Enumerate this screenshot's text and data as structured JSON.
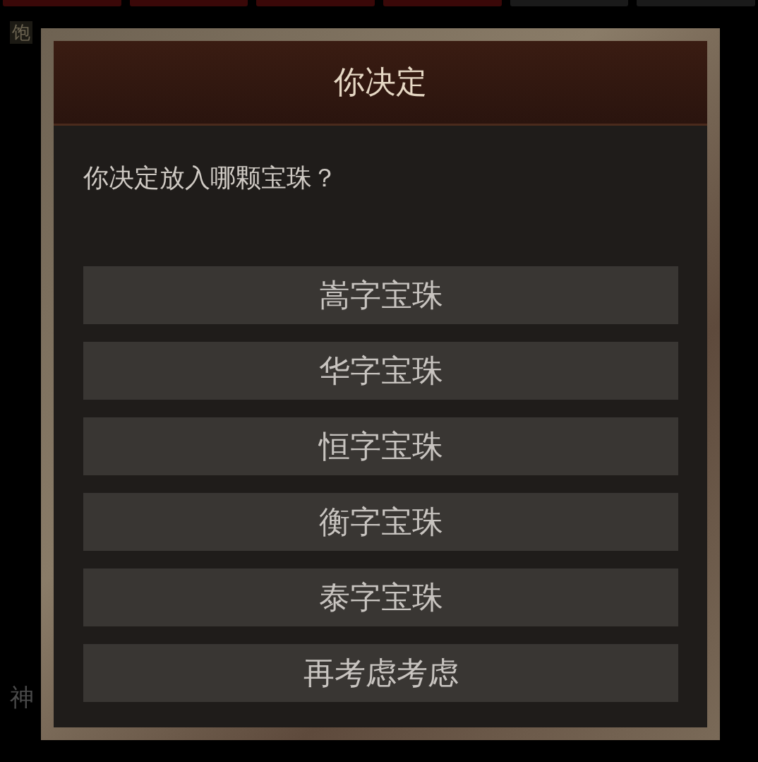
{
  "background": {
    "slots": [
      {
        "kind": "red"
      },
      {
        "kind": "red"
      },
      {
        "kind": "red"
      },
      {
        "kind": "red"
      },
      {
        "kind": "dark"
      },
      {
        "kind": "dark"
      }
    ],
    "status_badge": "饱",
    "side_label": "神"
  },
  "dialog": {
    "title": "你决定",
    "prompt": "你决定放入哪颗宝珠？",
    "options": [
      {
        "label": "嵩字宝珠"
      },
      {
        "label": "华字宝珠"
      },
      {
        "label": "恒字宝珠"
      },
      {
        "label": "衡字宝珠"
      },
      {
        "label": "泰字宝珠"
      },
      {
        "label": "再考虑考虑"
      }
    ]
  }
}
